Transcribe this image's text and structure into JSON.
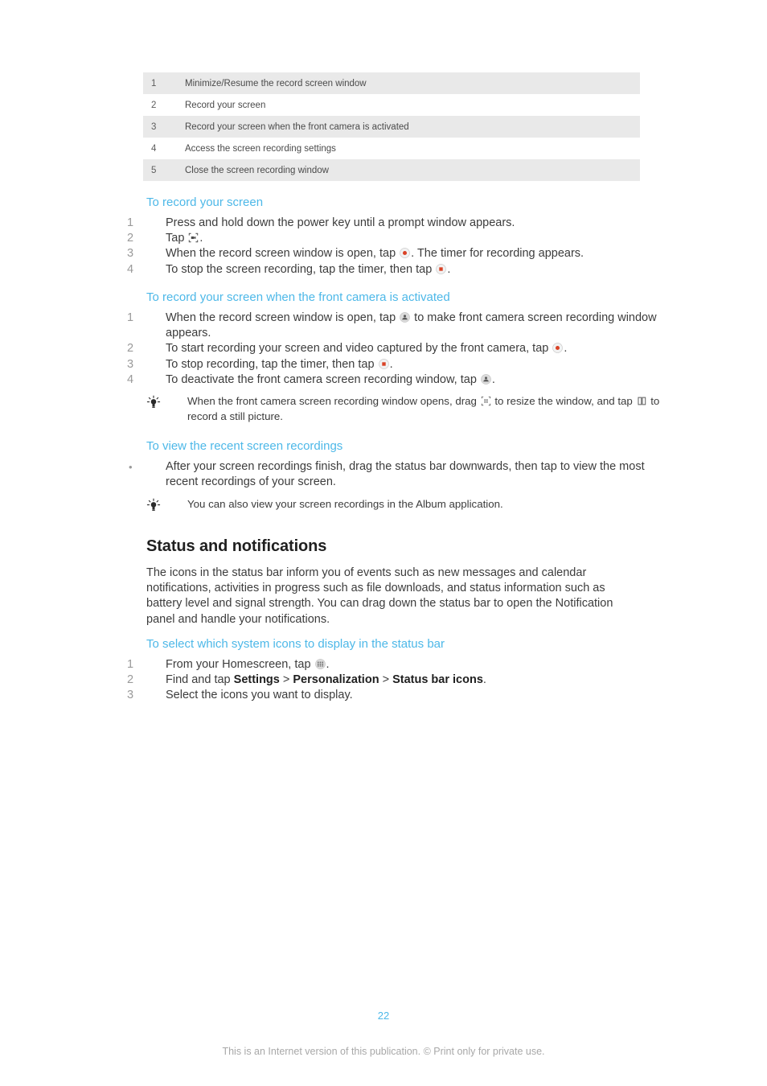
{
  "legend": {
    "rows": [
      {
        "num": "1",
        "desc": "Minimize/Resume the record screen window"
      },
      {
        "num": "2",
        "desc": "Record your screen"
      },
      {
        "num": "3",
        "desc": "Record your screen when the front camera is activated"
      },
      {
        "num": "4",
        "desc": "Access the screen recording settings"
      },
      {
        "num": "5",
        "desc": "Close the screen recording window"
      }
    ]
  },
  "record_screen": {
    "heading": "To record your screen",
    "step1_num": "1",
    "step1": "Press and hold down the power key until a prompt window appears.",
    "step2_num": "2",
    "step2_pre": "Tap ",
    "step2_post": ".",
    "step3_num": "3",
    "step3_pre": "When the record screen window is open, tap ",
    "step3_post": ". The timer for recording appears.",
    "step4_num": "4",
    "step4_pre": "To stop the screen recording, tap the timer, then tap ",
    "step4_post": "."
  },
  "front_camera": {
    "heading": "To record your screen when the front camera is activated",
    "step1_num": "1",
    "step1_pre": "When the record screen window is open, tap ",
    "step1_post": " to make front camera screen recording window appears.",
    "step2_num": "2",
    "step2_pre": "To start recording your screen and video captured by the front camera, tap ",
    "step2_post": ".",
    "step3_num": "3",
    "step3_pre": "To stop recording, tap the timer, then tap ",
    "step3_post": ".",
    "step4_num": "4",
    "step4_pre": "To deactivate the front camera screen recording window, tap ",
    "step4_post": "."
  },
  "tip_front_camera": {
    "pre": "When the front camera screen recording window opens, drag ",
    "mid": " to resize the window, and tap ",
    "post": " to record a still picture."
  },
  "recent_recordings": {
    "heading": "To view the recent screen recordings",
    "bullet": "•",
    "text": "After your screen recordings finish, drag the status bar downwards, then tap to view the most recent recordings of your screen."
  },
  "tip_album": {
    "text": "You can also view your screen recordings in the Album application."
  },
  "status_notifications": {
    "heading": "Status and notifications",
    "paragraph": "The icons in the status bar inform you of events such as new messages and calendar notifications, activities in progress such as file downloads, and status information such as battery level and signal strength. You can drag down the status bar to open the Notification panel and handle your notifications."
  },
  "system_icons": {
    "heading": "To select which system icons to display in the status bar",
    "step1_num": "1",
    "step1_pre": "From your Homescreen, tap ",
    "step1_post": ".",
    "step2_num": "2",
    "step2_pre": "Find and tap ",
    "step2_b1": "Settings",
    "step2_sep1": " > ",
    "step2_b2": "Personalization",
    "step2_sep2": " > ",
    "step2_b3": "Status bar icons",
    "step2_post": ".",
    "step3_num": "3",
    "step3": "Select the icons you want to display."
  },
  "footer": {
    "page_number": "22",
    "note": "This is an Internet version of this publication. © Print only for private use."
  },
  "colors": {
    "heading_blue": "#4db8e8",
    "table_shade": "#e9e9e9",
    "body_text": "#3c3c3c",
    "record_red": "#d94226",
    "muted": "#a8a8a8"
  },
  "icons": {
    "record_screen": "record-screen-icon",
    "record_dot": "record-dot-icon",
    "stop": "stop-recording-icon",
    "front_camera": "front-camera-icon",
    "resize": "resize-handle-icon",
    "still_picture": "still-picture-icon",
    "app_drawer": "app-drawer-icon",
    "tip_bulb": "tip-bulb-icon"
  }
}
